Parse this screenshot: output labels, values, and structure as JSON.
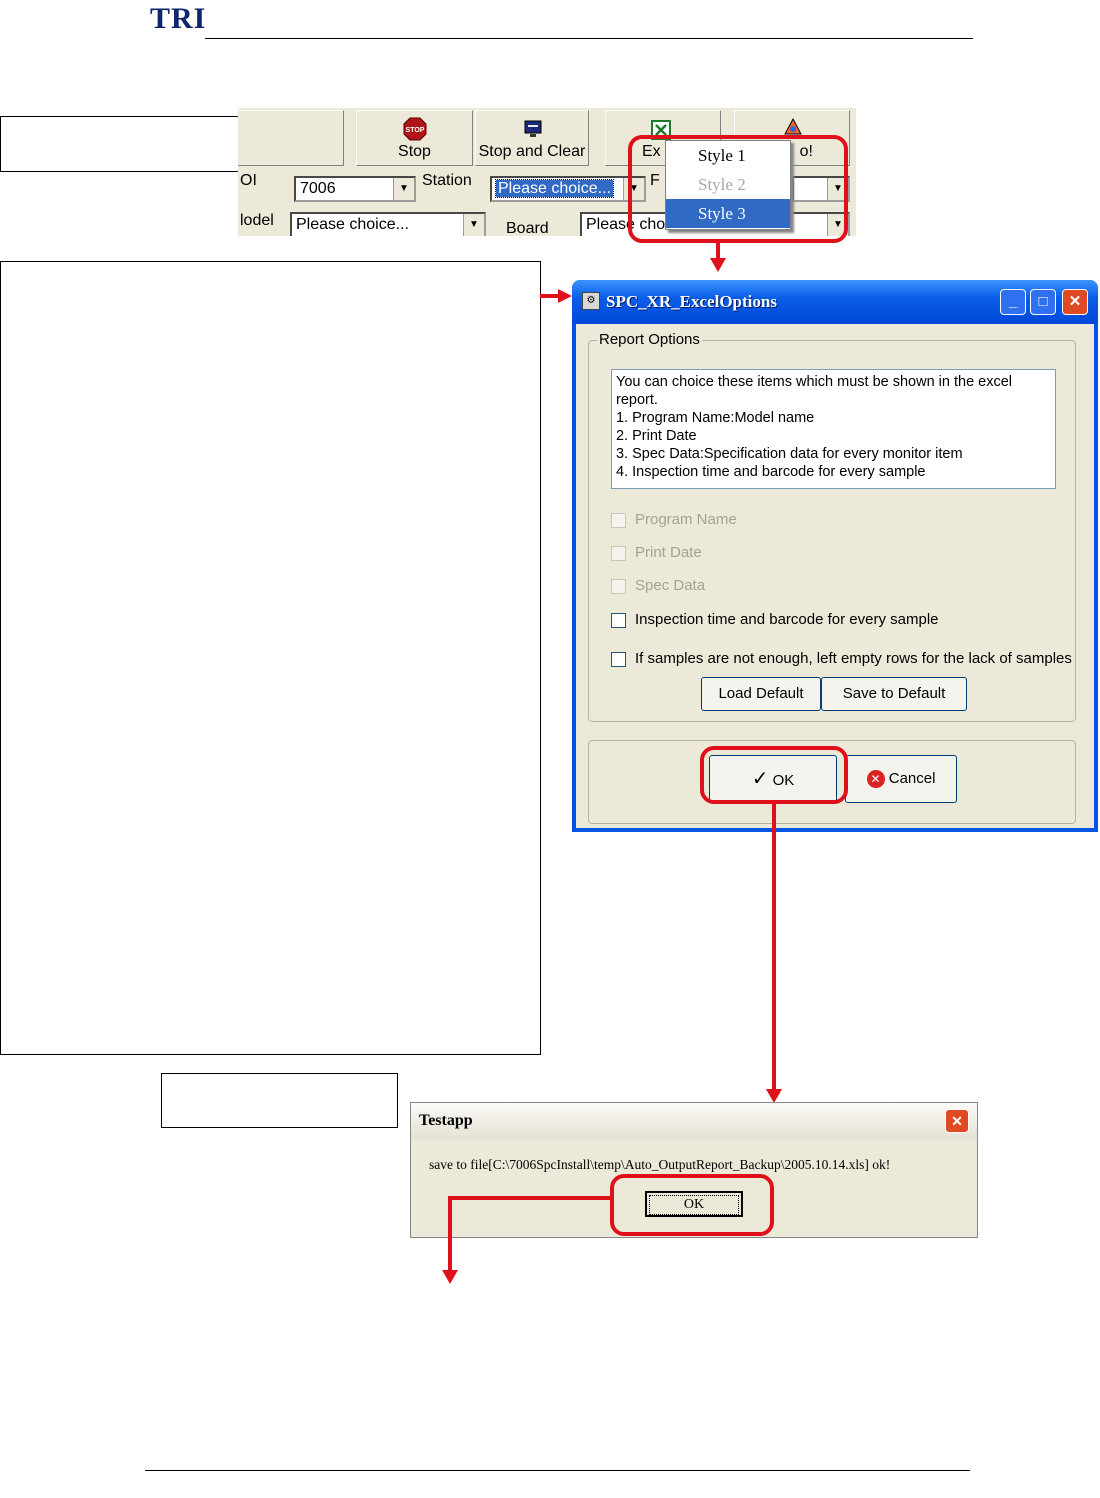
{
  "header": {
    "logo_text": "TRI"
  },
  "toolbar": {
    "stop_label": "Stop",
    "stop_clear_label": "Stop and Clear",
    "excel_label": "Ex",
    "next_label": "o!",
    "aoi_label": "OI",
    "aoi_value": "7006",
    "station_label": "Station",
    "station_value": "Please choice...",
    "f_label": "F",
    "model_label": "lodel",
    "model_value": "Please choice...",
    "board_label": "Board",
    "board_value": "Please cho"
  },
  "style_menu": {
    "items": [
      {
        "label": "Style 1",
        "state": "enabled"
      },
      {
        "label": "Style 2",
        "state": "disabled"
      },
      {
        "label": "Style 3",
        "state": "selected"
      }
    ]
  },
  "options_dialog": {
    "title": "SPC_XR_ExcelOptions",
    "group_title": "Report Options",
    "memo_lines": [
      "You can choice these items which must be shown in the excel",
      "report.",
      "1. Program Name:Model name",
      "2. Print Date",
      "3. Spec Data:Specification data for every monitor item",
      "4. Inspection time and barcode for every sample"
    ],
    "checkboxes": [
      {
        "label": "Program Name",
        "enabled": false
      },
      {
        "label": "Print Date",
        "enabled": false
      },
      {
        "label": "Spec Data",
        "enabled": false
      },
      {
        "label": "Inspection time and barcode for every sample",
        "enabled": true
      },
      {
        "label": "If samples are not enough, left empty rows for the lack of samples",
        "enabled": true
      }
    ],
    "load_default_label": "Load Default",
    "save_default_label": "Save to Default",
    "ok_label": "OK",
    "cancel_label": "Cancel"
  },
  "testapp_dialog": {
    "title": "Testapp",
    "message": "save to file[C:\\7006SpcInstall\\temp\\Auto_OutputReport_Backup\\2005.10.14.xls] ok!",
    "ok_label": "OK"
  },
  "colors": {
    "highlight": "#e0101a",
    "xp_title": "#0055e5",
    "menu_select": "#316ac5"
  }
}
